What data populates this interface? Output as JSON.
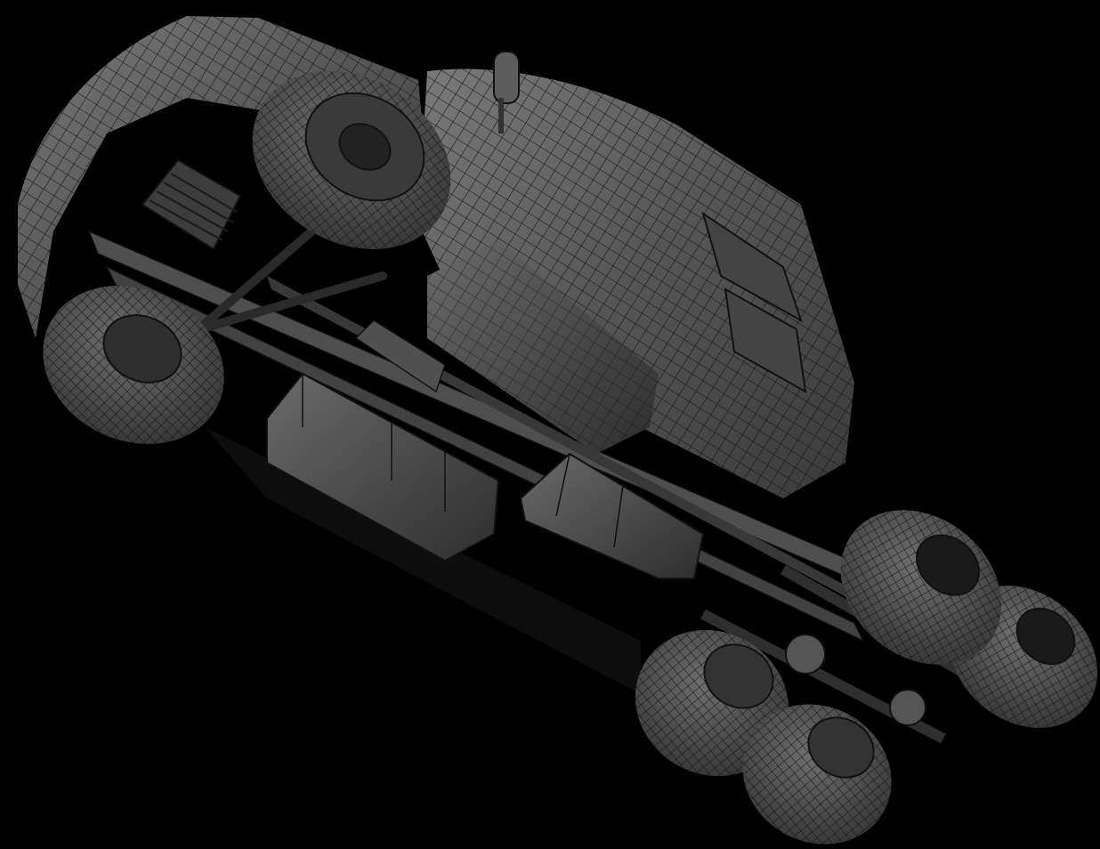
{
  "viewport": {
    "render_mode": "wireframe-on-shaded",
    "background": "#000000",
    "mesh_colors": {
      "surface_light": "#6e6e6e",
      "surface_mid": "#4a4a4a",
      "surface_dark": "#2a2a2a",
      "wire": "#111111"
    }
  }
}
